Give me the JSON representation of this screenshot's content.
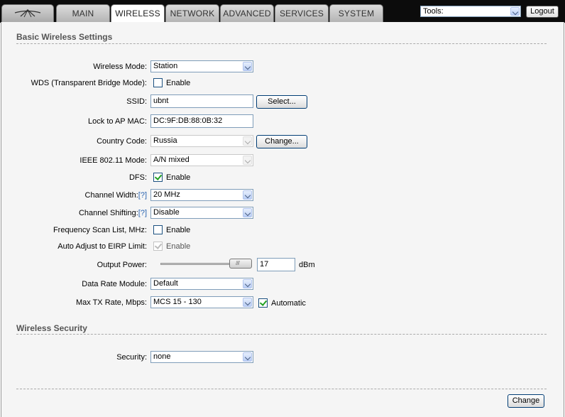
{
  "header": {
    "tabs": [
      {
        "label": "MAIN",
        "active": false
      },
      {
        "label": "WIRELESS",
        "active": true
      },
      {
        "label": "NETWORK",
        "active": false
      },
      {
        "label": "ADVANCED",
        "active": false
      },
      {
        "label": "SERVICES",
        "active": false
      },
      {
        "label": "SYSTEM",
        "active": false
      }
    ],
    "tools_select": "Tools:",
    "logout_label": "Logout"
  },
  "basic": {
    "title": "Basic Wireless Settings",
    "wireless_mode": {
      "label": "Wireless Mode:",
      "value": "Station"
    },
    "wds": {
      "label": "WDS (Transparent Bridge Mode):",
      "option": "Enable",
      "checked": false
    },
    "ssid": {
      "label": "SSID:",
      "value": "ubnt",
      "button": "Select..."
    },
    "lock_ap": {
      "label": "Lock to AP MAC:",
      "value": "DC:9F:DB:88:0B:32"
    },
    "country": {
      "label": "Country Code:",
      "value": "Russia",
      "button": "Change..."
    },
    "ieee_mode": {
      "label": "IEEE 802.11 Mode:",
      "value": "A/N mixed"
    },
    "dfs": {
      "label": "DFS:",
      "option": "Enable",
      "checked": true
    },
    "channel_width": {
      "label": "Channel Width:",
      "help": "[?]",
      "value": "20 MHz"
    },
    "channel_shifting": {
      "label": "Channel Shifting:",
      "help": "[?]",
      "value": "Disable"
    },
    "freq_scan": {
      "label": "Frequency Scan List, MHz:",
      "option": "Enable",
      "checked": false
    },
    "eirp": {
      "label": "Auto Adjust to EIRP Limit:",
      "option": "Enable",
      "checked": true
    },
    "output_power": {
      "label": "Output Power:",
      "value": "17",
      "unit": "dBm"
    },
    "data_rate": {
      "label": "Data Rate Module:",
      "value": "Default"
    },
    "max_tx": {
      "label": "Max TX Rate, Mbps:",
      "value": "MCS 15 - 130",
      "option": "Automatic",
      "checked": true
    }
  },
  "security": {
    "title": "Wireless Security",
    "security": {
      "label": "Security:",
      "value": "none"
    }
  },
  "footer": {
    "change_label": "Change"
  }
}
